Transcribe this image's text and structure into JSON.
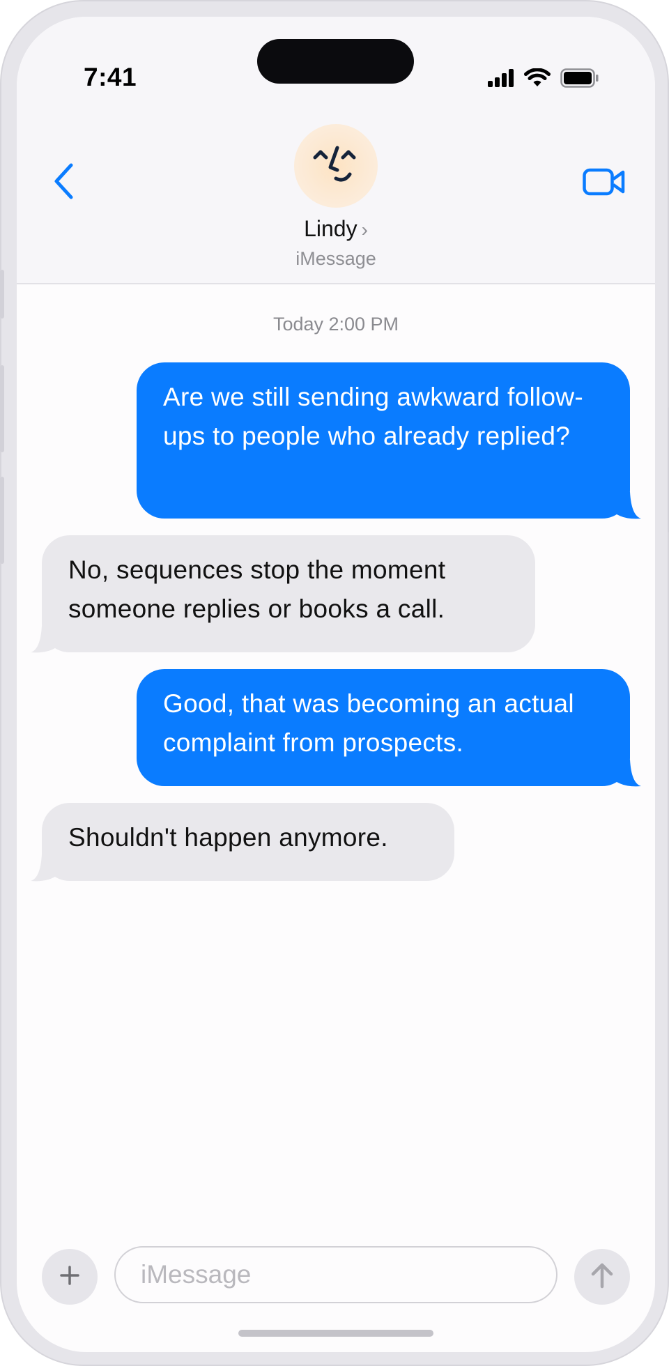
{
  "status_bar": {
    "time": "7:41",
    "icons": [
      "cellular-signal-icon",
      "wifi-icon",
      "battery-icon"
    ]
  },
  "header": {
    "contact_name": "Lindy",
    "chevron": "›",
    "service": "iMessage",
    "back_icon": "chevron-left-icon",
    "video_icon": "video-camera-icon",
    "avatar_icon": "smiley-face-icon"
  },
  "thread": {
    "timestamp": "Today 2:00 PM",
    "messages": [
      {
        "direction": "sent",
        "text": "Are we still sending awkward follow-ups to people who already replied?"
      },
      {
        "direction": "received",
        "text": "No, sequences stop the moment someone replies or books a call."
      },
      {
        "direction": "sent",
        "text": "Good, that was becoming an actual complaint from prospects."
      },
      {
        "direction": "received",
        "text": "Shouldn't happen anymore."
      }
    ]
  },
  "composer": {
    "placeholder": "iMessage",
    "plus_icon": "plus-icon",
    "send_icon": "arrow-up-icon"
  },
  "colors": {
    "accent": "#0a7cff",
    "sent_bubble": "#0a7cff",
    "received_bubble": "#e9e8ec",
    "secondary_text": "#8e8e93"
  }
}
